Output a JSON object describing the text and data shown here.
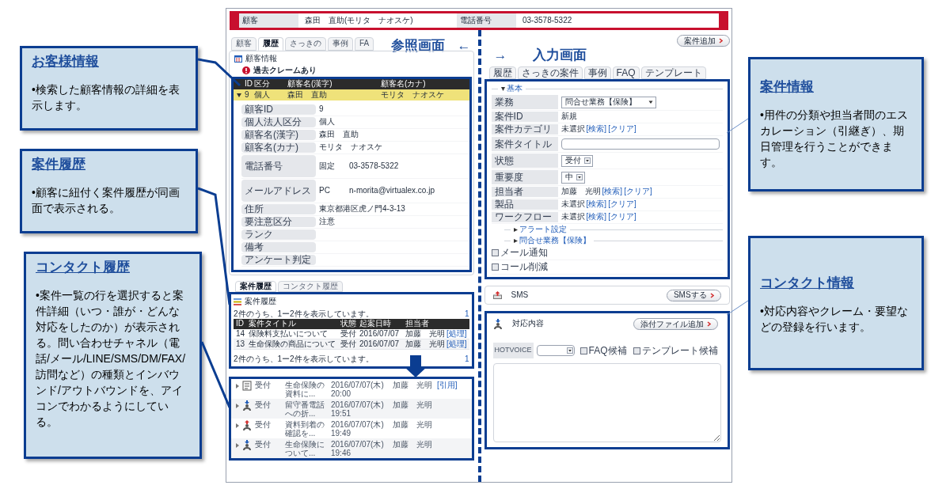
{
  "header": {
    "fields": [
      {
        "label": "顧客",
        "value": "森田　直助(モリタ　ナオスケ)"
      },
      {
        "label": "電話番号",
        "value": "03-3578-5322"
      }
    ]
  },
  "reference_panel": {
    "tabs": [
      {
        "label": "顧客",
        "selected": false
      },
      {
        "label": "履歴",
        "selected": true
      },
      {
        "label": "さっきの",
        "selected": false
      },
      {
        "label": "事例",
        "selected": false
      },
      {
        "label": "FA",
        "selected": false
      }
    ],
    "caption": "参照画面",
    "caption_arrow": "←",
    "customer_info": {
      "title": "顧客情報",
      "alert": "過去クレームあり",
      "columns": [
        "ID",
        "区分",
        "顧客名(漢字)",
        "顧客名(カナ)"
      ],
      "rows": [
        {
          "expanded": true,
          "selected": true,
          "cells": [
            "9",
            "個人",
            "森田　直助",
            "モリタ　ナオスケ"
          ]
        }
      ],
      "details": [
        {
          "label": "顧客ID",
          "value": "9"
        },
        {
          "label": "個人法人区分",
          "value": "個人"
        },
        {
          "label": "顧客名(漢字)",
          "value": "森田　直助"
        },
        {
          "label": "顧客名(カナ)",
          "value": "モリタ　ナオスケ"
        },
        {
          "label": "電話番号",
          "type": "固定",
          "value": "03-3578-5322"
        },
        {
          "label": "メールアドレス",
          "type": "PC",
          "value": "n-morita@virtualex.co.jp"
        },
        {
          "label": "住所",
          "value": "東京都港区虎ノ門4-3-13"
        },
        {
          "label": "要注意区分",
          "value": "注意"
        },
        {
          "label": "ランク"
        },
        {
          "label": "備考"
        },
        {
          "label": "アンケート判定"
        }
      ]
    },
    "history_tabs": [
      {
        "label": "案件履歴",
        "selected": true
      },
      {
        "label": "コンタクト履歴",
        "selected": false
      }
    ],
    "case_history": {
      "title": "案件履歴",
      "summary": "2件のうち、1ー2件を表示しています。",
      "page": "1",
      "columns": [
        "ID",
        "案件タイトル",
        "状態",
        "起案日時",
        "担当者"
      ],
      "rows": [
        {
          "cells": [
            "14",
            "保険料支払いについて",
            "受付",
            "2016/07/07",
            "加藤　光明"
          ],
          "action": "[処理]"
        },
        {
          "cells": [
            "13",
            "生命保険の商品について",
            "受付",
            "2016/07/07",
            "加藤　光明"
          ],
          "action": "[処理]"
        }
      ],
      "footer_summary": "2件のうち、1ー2件を表示しています。",
      "footer_page": "1"
    },
    "contacts": [
      {
        "kind": "document",
        "status": "受付",
        "title": "生命保険の資料に...",
        "date": "2016/07/07(木)",
        "time": "20:00",
        "agent": "加藤　光明",
        "action": "[引用]"
      },
      {
        "kind": "inbound",
        "status": "受付",
        "title": "留守番電話への折...",
        "date": "2016/07/07(木)",
        "time": "19:51",
        "agent": "加藤　光明"
      },
      {
        "kind": "outbound",
        "status": "受付",
        "title": "資料到着の確認を...",
        "date": "2016/07/07(木)",
        "time": "19:49",
        "agent": "加藤　光明"
      },
      {
        "kind": "inbound",
        "status": "受付",
        "title": "生命保険について...",
        "date": "2016/07/07(木)",
        "time": "19:46",
        "agent": "加藤　光明"
      }
    ]
  },
  "input_panel": {
    "add_button": "案件追加",
    "caption_arrow": "→",
    "caption": "入力画面",
    "tabs": [
      {
        "label": "履歴",
        "selected": false
      },
      {
        "label": "さっきの案件",
        "selected": false
      },
      {
        "label": "事例",
        "selected": false
      },
      {
        "label": "FAQ",
        "selected": false
      },
      {
        "label": "テンプレート",
        "selected": false
      }
    ],
    "basic_section": {
      "title": "基本",
      "expanded": true
    },
    "fields": [
      {
        "kind": "select",
        "label": "業務",
        "value": "問合せ業務【保険】"
      },
      {
        "kind": "text",
        "label": "案件ID",
        "value": "新規"
      },
      {
        "kind": "lookup",
        "label": "案件カテゴリ",
        "value": "未選択",
        "links": [
          "[検索]",
          "[クリア]"
        ]
      },
      {
        "kind": "input",
        "label": "案件タイトル"
      },
      {
        "kind": "small_select",
        "label": "状態",
        "value": "受付"
      },
      {
        "kind": "small_select",
        "label": "重要度",
        "value": "中"
      },
      {
        "kind": "lookup",
        "label": "担当者",
        "value": "加藤　光明",
        "links": [
          "[検索]",
          "[クリア]"
        ]
      },
      {
        "kind": "lookup",
        "label": "製品",
        "value": "未選択",
        "links": [
          "[検索]",
          "[クリア]"
        ]
      },
      {
        "kind": "lookup",
        "label": "ワークフロー",
        "value": "未選択",
        "links": [
          "[検索]",
          "[クリア]"
        ]
      }
    ],
    "subsections": [
      {
        "title": "アラート設定",
        "expanded": false
      },
      {
        "title": "問合せ業務【保険】",
        "expanded": false
      }
    ],
    "checkboxes": [
      {
        "label": "メール通知",
        "checked": false
      },
      {
        "label": "コール削減",
        "checked": false
      }
    ],
    "sms": {
      "label": "SMS",
      "button": "SMSする"
    },
    "contact_entry": {
      "title": "対応内容",
      "button": "添付ファイル追加",
      "hotvoice_label": "HOTVOICE",
      "checkboxes": [
        {
          "label": "FAQ候補",
          "checked": false
        },
        {
          "label": "テンプレート候補",
          "checked": false
        }
      ]
    }
  },
  "callouts": [
    {
      "title": "お客様情報",
      "body": "•検索した顧客情報の詳細を表示します。"
    },
    {
      "title": "案件履歴",
      "body": "•顧客に紐付く案件履歴が同画面で表示される。"
    },
    {
      "title": "コンタクト履歴",
      "body": "•案件一覧の行を選択すると案件詳細（いつ・誰が・どんな対応をしたのか）が表示される。問い合わせチャネル（電話/メール/LINE/SMS/DM/FAX/訪問など）の種類とインバウンド/アウトバウンドを、アイコンでわかるようにしている。"
    },
    {
      "title": "案件情報",
      "body": "•用件の分類や担当者間のエスカレーション（引継ぎ）、期日管理を行うことができます。"
    },
    {
      "title": "コンタクト情報",
      "body": "•対応内容やクレーム・要望などの登録を行います。"
    }
  ]
}
